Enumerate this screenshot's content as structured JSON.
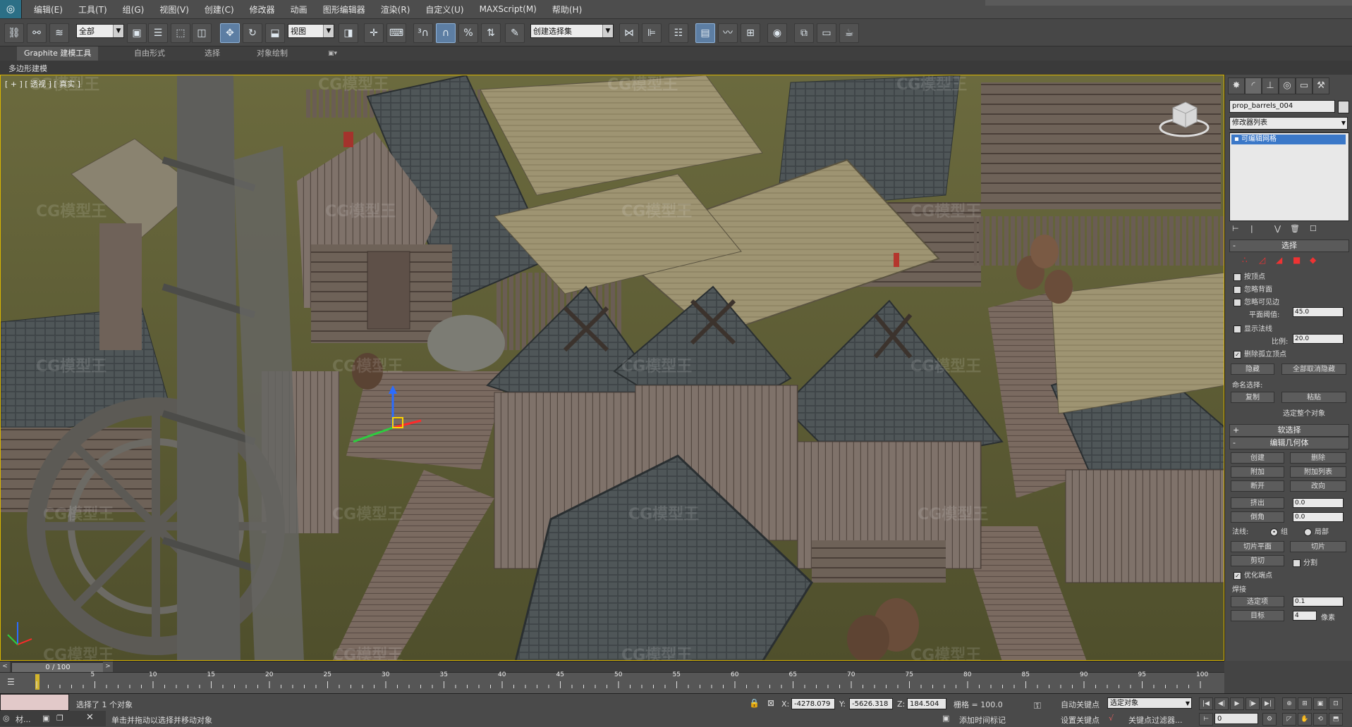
{
  "menubar": {
    "items": [
      "编辑(E)",
      "工具(T)",
      "组(G)",
      "视图(V)",
      "创建(C)",
      "修改器",
      "动画",
      "图形编辑器",
      "渲染(R)",
      "自定义(U)",
      "MAXScript(M)",
      "帮助(H)"
    ]
  },
  "toolbar": {
    "selection_filter": "全部",
    "reference_coord": "视图",
    "named_selection": "创建选择集"
  },
  "ribbon": {
    "tabs": [
      "Graphite 建模工具",
      "自由形式",
      "选择",
      "对象绘制"
    ],
    "subtitle": "多边形建模"
  },
  "viewport": {
    "label": "[ + ] [ 透视 ] [ 真实 ]",
    "watermark": "CG模型王"
  },
  "command_panel": {
    "object_name": "prop_barrels_004",
    "modifier_list": "修改器列表",
    "stack_item": "可编辑网格",
    "rollouts": {
      "selection": {
        "title": "选择",
        "by_vertex": "按顶点",
        "ignore_backfacing": "忽略背面",
        "ignore_visible_edges": "忽略可见边",
        "planar_threshold_label": "平面阈值:",
        "planar_threshold": "45.0",
        "show_normals": "显示法线",
        "scale_label": "比例:",
        "scale": "20.0",
        "delete_isolated": "删除孤立顶点",
        "hide": "隐藏",
        "unhide_all": "全部取消隐藏",
        "named_selections": "命名选择:",
        "copy": "复制",
        "paste": "粘贴",
        "selected_whole": "选定整个对象"
      },
      "soft_selection": {
        "title": "软选择"
      },
      "edit_geometry": {
        "title": "编辑几何体",
        "create": "创建",
        "delete": "删除",
        "attach": "附加",
        "attach_list": "附加列表",
        "break": "断开",
        "turn": "改向",
        "extrude": "挤出",
        "extrude_val": "0.0",
        "bevel": "倒角",
        "bevel_val": "0.0",
        "normal_label": "法线:",
        "group": "组",
        "local": "局部",
        "slice_plane": "切片平面",
        "slice": "切片",
        "cut": "剪切",
        "split": "分割",
        "refine_ends": "优化端点",
        "weld": "焊接",
        "selected": "选定项",
        "selected_val": "0.1",
        "target": "目标",
        "target_val": "4",
        "pixels": "像素"
      }
    }
  },
  "timeline": {
    "frame": "0 / 100",
    "ticks": [
      "0",
      "5",
      "10",
      "15",
      "20",
      "25",
      "30",
      "35",
      "40",
      "45",
      "50",
      "55",
      "60",
      "65",
      "70",
      "75",
      "80",
      "85",
      "90",
      "95",
      "100"
    ]
  },
  "status": {
    "selected_msg": "选择了 1 个对象",
    "prompt": "单击并拖动以选择并移动对象",
    "x_label": "X:",
    "x": "-4278.079",
    "y_label": "Y:",
    "y": "-5626.318",
    "z_label": "Z:",
    "z": "184.504",
    "grid": "栅格 = 100.0",
    "add_time_tag": "添加时间标记",
    "auto_key": "自动关键点",
    "set_key": "设置关键点",
    "key_selection": "选定对象",
    "key_filters": "关键点过滤器...",
    "current_frame": "0",
    "script_label": "材..."
  },
  "colors": {
    "accent": "#5d7ea3",
    "viewport_border": "#d9b500",
    "stack_highlight": "#3b78c8"
  }
}
